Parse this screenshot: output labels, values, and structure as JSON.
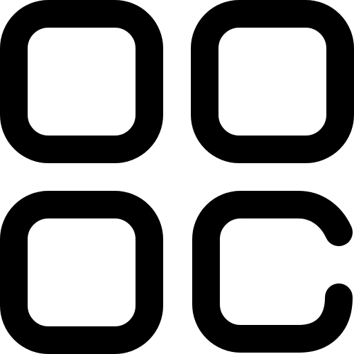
{
  "icon": {
    "name": "apps-grid-icon",
    "stroke_color": "#000000",
    "background_color": "#ffffff",
    "tiles": [
      {
        "name": "tile-top-left",
        "shape": "rounded-square"
      },
      {
        "name": "tile-top-right",
        "shape": "rounded-square"
      },
      {
        "name": "tile-bottom-left",
        "shape": "rounded-square"
      },
      {
        "name": "tile-bottom-right",
        "shape": "open-rounded-square"
      }
    ]
  }
}
